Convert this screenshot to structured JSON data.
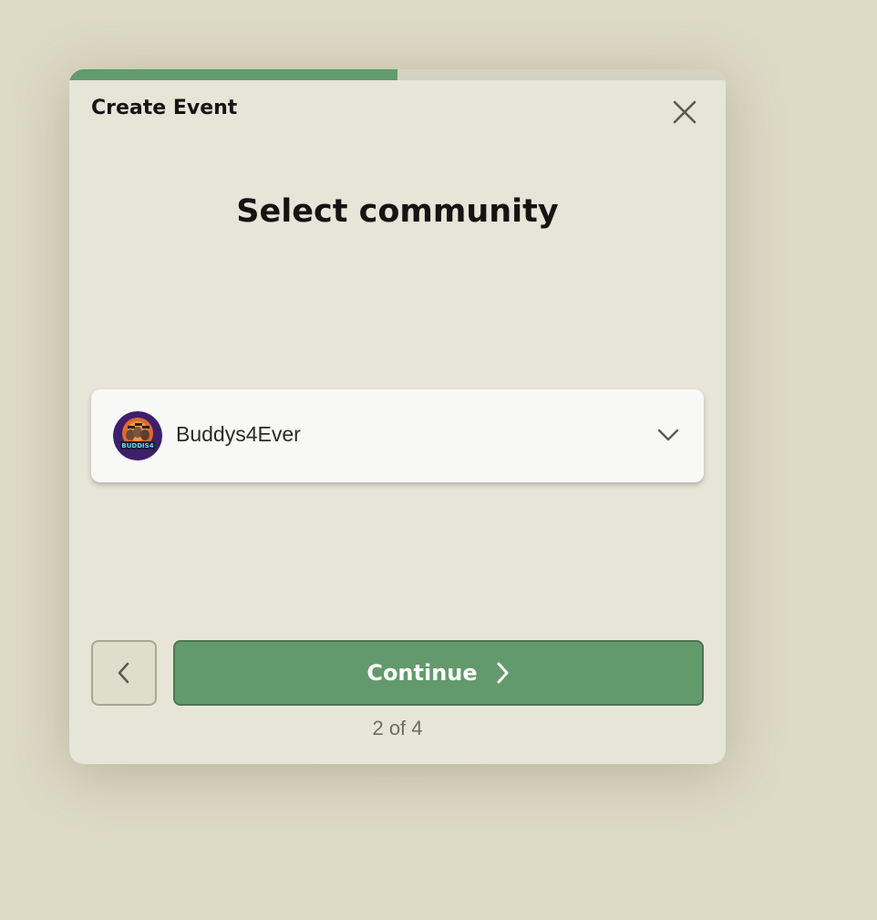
{
  "modal": {
    "title": "Create Event",
    "heading": "Select community",
    "progress": 0.5
  },
  "community_select": {
    "selected_label": "Buddys4Ever",
    "avatar_text": "BUDDIS4"
  },
  "footer": {
    "continue_label": "Continue",
    "step_text": "2 of 4"
  },
  "icons": {
    "close": "close-icon",
    "dropdown": "chevron-down-icon",
    "back": "chevron-left-icon",
    "continue": "chevron-right-icon"
  },
  "colors": {
    "accent": "#629a6b",
    "modal_bg": "#e7e5d7",
    "page_bg": "#dcd9c5"
  }
}
